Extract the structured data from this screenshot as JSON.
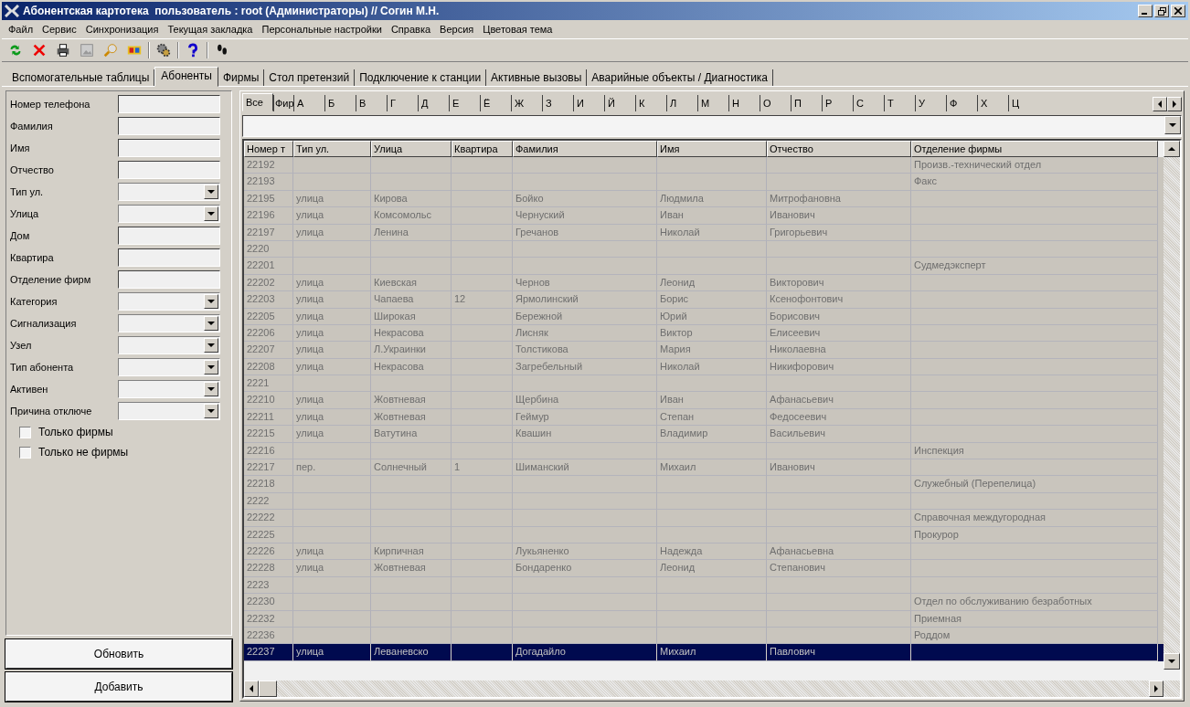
{
  "window": {
    "title": "Абонентская картотека  пользователь : root (Администраторы) // Согин М.Н."
  },
  "menu": [
    "Файл",
    "Сервис",
    "Синхронизация",
    "Текущая закладка",
    "Персональные настройки",
    "Справка",
    "Версия",
    "Цветовая тема"
  ],
  "tabs": [
    {
      "label": "Вспомогательные таблицы",
      "selected": false
    },
    {
      "label": "Абоненты",
      "selected": true
    },
    {
      "label": "Фирмы",
      "selected": false
    },
    {
      "label": "Стол претензий",
      "selected": false
    },
    {
      "label": "Подключение к станции",
      "selected": false
    },
    {
      "label": "Активные вызовы",
      "selected": false
    },
    {
      "label": "Аварийные объекты / Диагностика",
      "selected": false
    }
  ],
  "filters": [
    {
      "label": "Номер телефона",
      "kind": "text"
    },
    {
      "label": "Фамилия",
      "kind": "text"
    },
    {
      "label": "Имя",
      "kind": "text"
    },
    {
      "label": "Отчество",
      "kind": "text"
    },
    {
      "label": "Тип ул.",
      "kind": "combo"
    },
    {
      "label": "Улица",
      "kind": "combo"
    },
    {
      "label": "Дом",
      "kind": "text"
    },
    {
      "label": "Квартира",
      "kind": "text"
    },
    {
      "label": "Отделение фирм",
      "kind": "text"
    },
    {
      "label": "Категория",
      "kind": "combo"
    },
    {
      "label": "Сигнализация",
      "kind": "combo"
    },
    {
      "label": "Узел",
      "kind": "combo"
    },
    {
      "label": "Тип абонента",
      "kind": "combo"
    },
    {
      "label": "Активен",
      "kind": "combo"
    },
    {
      "label": "Причина отключе",
      "kind": "combo"
    }
  ],
  "checkboxes": [
    {
      "label": "Только фирмы",
      "checked": false
    },
    {
      "label": "Только не фирмы",
      "checked": false
    }
  ],
  "buttons": [
    "Обновить",
    "Добавить"
  ],
  "letter_tabs": [
    {
      "label": "Все",
      "selected": true
    },
    {
      "label": "Фир",
      "selected": false
    },
    {
      "label": "А",
      "selected": false
    },
    {
      "label": "Б",
      "selected": false
    },
    {
      "label": "В",
      "selected": false
    },
    {
      "label": "Г",
      "selected": false
    },
    {
      "label": "Д",
      "selected": false
    },
    {
      "label": "Е",
      "selected": false
    },
    {
      "label": "Ё",
      "selected": false
    },
    {
      "label": "Ж",
      "selected": false
    },
    {
      "label": "З",
      "selected": false
    },
    {
      "label": "И",
      "selected": false
    },
    {
      "label": "Й",
      "selected": false
    },
    {
      "label": "К",
      "selected": false
    },
    {
      "label": "Л",
      "selected": false
    },
    {
      "label": "М",
      "selected": false
    },
    {
      "label": "Н",
      "selected": false
    },
    {
      "label": "О",
      "selected": false
    },
    {
      "label": "П",
      "selected": false
    },
    {
      "label": "Р",
      "selected": false
    },
    {
      "label": "С",
      "selected": false
    },
    {
      "label": "Т",
      "selected": false
    },
    {
      "label": "У",
      "selected": false
    },
    {
      "label": "Ф",
      "selected": false
    },
    {
      "label": "Х",
      "selected": false
    },
    {
      "label": "Ц",
      "selected": false
    }
  ],
  "table": {
    "columns": [
      "Номер т",
      "Тип ул.",
      "Улица",
      "Квартира",
      "Фамилия",
      "Имя",
      "Отчество",
      "Отделение фирмы"
    ],
    "rows": [
      {
        "number": "22192",
        "department": "Произв.-технический отдел",
        "selected": false
      },
      {
        "number": "22193",
        "department": "Факс",
        "selected": false
      },
      {
        "number": "22195",
        "street_type": "улица",
        "street": "Кирова",
        "surname": "Бойко",
        "name": "Людмила",
        "patronymic": "Митрофановна",
        "selected": false
      },
      {
        "number": "22196",
        "street_type": "улица",
        "street": "Комсомольс",
        "surname": "Чернуский",
        "name": "Иван",
        "patronymic": "Иванович",
        "selected": false
      },
      {
        "number": "22197",
        "street_type": "улица",
        "street": "Ленина",
        "surname": "Гречанов",
        "name": "Николай",
        "patronymic": "Григорьевич",
        "selected": false
      },
      {
        "number": "2220",
        "selected": false
      },
      {
        "number": "22201",
        "department": "Судмедэксперт",
        "selected": false
      },
      {
        "number": "22202",
        "street_type": "улица",
        "street": "Киевская",
        "surname": "Чернов",
        "name": "Леонид",
        "patronymic": "Викторович",
        "selected": false
      },
      {
        "number": "22203",
        "street_type": "улица",
        "street": "Чапаева",
        "apartment": "12",
        "surname": "Ярмолинский",
        "name": "Борис",
        "patronymic": "Ксенофонтович",
        "selected": false
      },
      {
        "number": "22205",
        "street_type": "улица",
        "street": "Широкая",
        "surname": "Бережной",
        "name": "Юрий",
        "patronymic": "Борисович",
        "selected": false
      },
      {
        "number": "22206",
        "street_type": "улица",
        "street": "Некрасова",
        "surname": "Лисняк",
        "name": "Виктор",
        "patronymic": "Елисеевич",
        "selected": false
      },
      {
        "number": "22207",
        "street_type": "улица",
        "street": "Л.Украинки",
        "surname": "Толстикова",
        "name": "Мария",
        "patronymic": "Николаевна",
        "selected": false
      },
      {
        "number": "22208",
        "street_type": "улица",
        "street": "Некрасова",
        "surname": "Загребельный",
        "name": "Николай",
        "patronymic": "Никифорович",
        "selected": false
      },
      {
        "number": "2221",
        "selected": false
      },
      {
        "number": "22210",
        "street_type": "улица",
        "street": "Жовтневая",
        "surname": "Щербина",
        "name": "Иван",
        "patronymic": "Афанасьевич",
        "selected": false
      },
      {
        "number": "22211",
        "street_type": "улица",
        "street": "Жовтневая",
        "surname": "Геймур",
        "name": "Степан",
        "patronymic": "Федосеевич",
        "selected": false
      },
      {
        "number": "22215",
        "street_type": "улица",
        "street": "Ватутина",
        "surname": "Квашин",
        "name": "Владимир",
        "patronymic": "Васильевич",
        "selected": false
      },
      {
        "number": "22216",
        "department": "Инспекция",
        "selected": false
      },
      {
        "number": "22217",
        "street_type": "пер.",
        "street": "Солнечный",
        "apartment": "1",
        "surname": "Шиманский",
        "name": "Михаил",
        "patronymic": "Иванович",
        "selected": false
      },
      {
        "number": "22218",
        "department": "Служебный (Перепелица)",
        "selected": false
      },
      {
        "number": "2222",
        "selected": false
      },
      {
        "number": "22222",
        "department": "Справочная междугородная",
        "selected": false
      },
      {
        "number": "22225",
        "department": "Прокурор",
        "selected": false
      },
      {
        "number": "22226",
        "street_type": "улица",
        "street": "Кирпичная",
        "surname": "Лукьяненко",
        "name": "Надежда",
        "patronymic": "Афанасьевна",
        "selected": false
      },
      {
        "number": "22228",
        "street_type": "улица",
        "street": "Жовтневая",
        "surname": "Бондаренко",
        "name": "Леонид",
        "patronymic": "Степанович",
        "selected": false
      },
      {
        "number": "2223",
        "selected": false
      },
      {
        "number": "22230",
        "department": "Отдел по обслуживанию безработных",
        "selected": false
      },
      {
        "number": "22232",
        "department": "Приемная",
        "selected": false
      },
      {
        "number": "22236",
        "department": "Роддом",
        "selected": false
      },
      {
        "number": "22237",
        "street_type": "улица",
        "street": "Леваневско",
        "surname": "Догадайло",
        "name": "Михаил",
        "patronymic": "Павлович",
        "selected": true
      }
    ]
  }
}
